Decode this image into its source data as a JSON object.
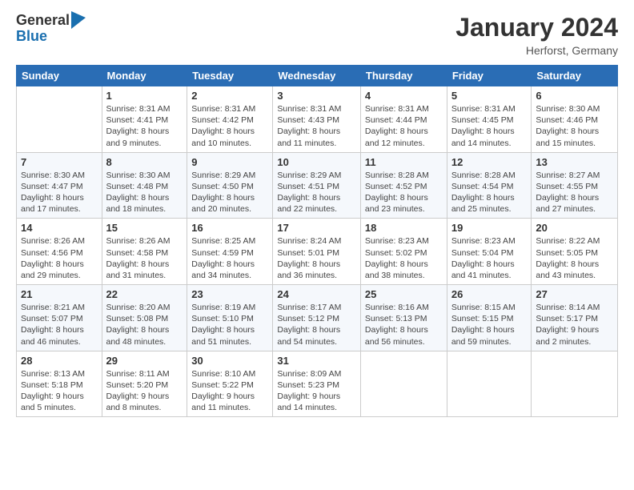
{
  "logo": {
    "general": "General",
    "blue": "Blue"
  },
  "header": {
    "title": "January 2024",
    "location": "Herforst, Germany"
  },
  "weekdays": [
    "Sunday",
    "Monday",
    "Tuesday",
    "Wednesday",
    "Thursday",
    "Friday",
    "Saturday"
  ],
  "weeks": [
    [
      {
        "day": "",
        "info": ""
      },
      {
        "day": "1",
        "info": "Sunrise: 8:31 AM\nSunset: 4:41 PM\nDaylight: 8 hours\nand 9 minutes."
      },
      {
        "day": "2",
        "info": "Sunrise: 8:31 AM\nSunset: 4:42 PM\nDaylight: 8 hours\nand 10 minutes."
      },
      {
        "day": "3",
        "info": "Sunrise: 8:31 AM\nSunset: 4:43 PM\nDaylight: 8 hours\nand 11 minutes."
      },
      {
        "day": "4",
        "info": "Sunrise: 8:31 AM\nSunset: 4:44 PM\nDaylight: 8 hours\nand 12 minutes."
      },
      {
        "day": "5",
        "info": "Sunrise: 8:31 AM\nSunset: 4:45 PM\nDaylight: 8 hours\nand 14 minutes."
      },
      {
        "day": "6",
        "info": "Sunrise: 8:30 AM\nSunset: 4:46 PM\nDaylight: 8 hours\nand 15 minutes."
      }
    ],
    [
      {
        "day": "7",
        "info": "Sunrise: 8:30 AM\nSunset: 4:47 PM\nDaylight: 8 hours\nand 17 minutes."
      },
      {
        "day": "8",
        "info": "Sunrise: 8:30 AM\nSunset: 4:48 PM\nDaylight: 8 hours\nand 18 minutes."
      },
      {
        "day": "9",
        "info": "Sunrise: 8:29 AM\nSunset: 4:50 PM\nDaylight: 8 hours\nand 20 minutes."
      },
      {
        "day": "10",
        "info": "Sunrise: 8:29 AM\nSunset: 4:51 PM\nDaylight: 8 hours\nand 22 minutes."
      },
      {
        "day": "11",
        "info": "Sunrise: 8:28 AM\nSunset: 4:52 PM\nDaylight: 8 hours\nand 23 minutes."
      },
      {
        "day": "12",
        "info": "Sunrise: 8:28 AM\nSunset: 4:54 PM\nDaylight: 8 hours\nand 25 minutes."
      },
      {
        "day": "13",
        "info": "Sunrise: 8:27 AM\nSunset: 4:55 PM\nDaylight: 8 hours\nand 27 minutes."
      }
    ],
    [
      {
        "day": "14",
        "info": "Sunrise: 8:26 AM\nSunset: 4:56 PM\nDaylight: 8 hours\nand 29 minutes."
      },
      {
        "day": "15",
        "info": "Sunrise: 8:26 AM\nSunset: 4:58 PM\nDaylight: 8 hours\nand 31 minutes."
      },
      {
        "day": "16",
        "info": "Sunrise: 8:25 AM\nSunset: 4:59 PM\nDaylight: 8 hours\nand 34 minutes."
      },
      {
        "day": "17",
        "info": "Sunrise: 8:24 AM\nSunset: 5:01 PM\nDaylight: 8 hours\nand 36 minutes."
      },
      {
        "day": "18",
        "info": "Sunrise: 8:23 AM\nSunset: 5:02 PM\nDaylight: 8 hours\nand 38 minutes."
      },
      {
        "day": "19",
        "info": "Sunrise: 8:23 AM\nSunset: 5:04 PM\nDaylight: 8 hours\nand 41 minutes."
      },
      {
        "day": "20",
        "info": "Sunrise: 8:22 AM\nSunset: 5:05 PM\nDaylight: 8 hours\nand 43 minutes."
      }
    ],
    [
      {
        "day": "21",
        "info": "Sunrise: 8:21 AM\nSunset: 5:07 PM\nDaylight: 8 hours\nand 46 minutes."
      },
      {
        "day": "22",
        "info": "Sunrise: 8:20 AM\nSunset: 5:08 PM\nDaylight: 8 hours\nand 48 minutes."
      },
      {
        "day": "23",
        "info": "Sunrise: 8:19 AM\nSunset: 5:10 PM\nDaylight: 8 hours\nand 51 minutes."
      },
      {
        "day": "24",
        "info": "Sunrise: 8:17 AM\nSunset: 5:12 PM\nDaylight: 8 hours\nand 54 minutes."
      },
      {
        "day": "25",
        "info": "Sunrise: 8:16 AM\nSunset: 5:13 PM\nDaylight: 8 hours\nand 56 minutes."
      },
      {
        "day": "26",
        "info": "Sunrise: 8:15 AM\nSunset: 5:15 PM\nDaylight: 8 hours\nand 59 minutes."
      },
      {
        "day": "27",
        "info": "Sunrise: 8:14 AM\nSunset: 5:17 PM\nDaylight: 9 hours\nand 2 minutes."
      }
    ],
    [
      {
        "day": "28",
        "info": "Sunrise: 8:13 AM\nSunset: 5:18 PM\nDaylight: 9 hours\nand 5 minutes."
      },
      {
        "day": "29",
        "info": "Sunrise: 8:11 AM\nSunset: 5:20 PM\nDaylight: 9 hours\nand 8 minutes."
      },
      {
        "day": "30",
        "info": "Sunrise: 8:10 AM\nSunset: 5:22 PM\nDaylight: 9 hours\nand 11 minutes."
      },
      {
        "day": "31",
        "info": "Sunrise: 8:09 AM\nSunset: 5:23 PM\nDaylight: 9 hours\nand 14 minutes."
      },
      {
        "day": "",
        "info": ""
      },
      {
        "day": "",
        "info": ""
      },
      {
        "day": "",
        "info": ""
      }
    ]
  ]
}
